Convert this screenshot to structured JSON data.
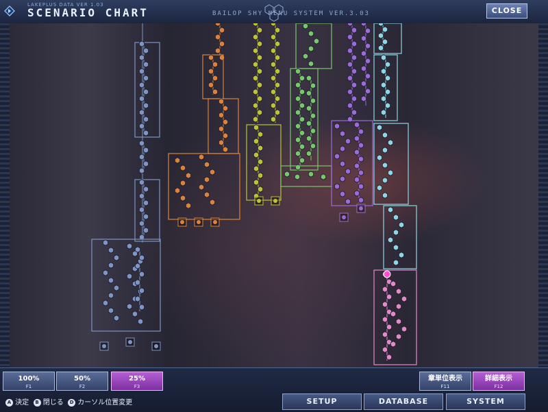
{
  "header": {
    "subtitle": "LAKEPLUS DATA VER 1.03",
    "title": "SCENARIO CHART",
    "version": "BAILOP SHY MENU SYSTEM VER.3.03",
    "close_label": "CLOSE"
  },
  "zoom_buttons": [
    {
      "label": "100%",
      "key": "F1",
      "active": false
    },
    {
      "label": "50%",
      "key": "F2",
      "active": false
    },
    {
      "label": "25%",
      "key": "F3",
      "active": true
    }
  ],
  "view_buttons": [
    {
      "label": "章単位表示",
      "key": "F11",
      "active": false
    },
    {
      "label": "詳細表示",
      "key": "F12",
      "active": true
    }
  ],
  "help": {
    "items": [
      {
        "key": "A",
        "text": "決定"
      },
      {
        "key": "B",
        "text": "閉じる"
      },
      {
        "key": "D",
        "text": "カーソル位置変更"
      }
    ]
  },
  "menu": {
    "setup": "SETUP",
    "database": "DATABASE",
    "system": "SYSTEM"
  },
  "routes": [
    {
      "color": "#7f95c4"
    },
    {
      "color": "#d9833e"
    },
    {
      "color": "#bcc23a"
    },
    {
      "color": "#77c86a"
    },
    {
      "color": "#9b6bd8"
    },
    {
      "color": "#8ed6e4"
    },
    {
      "color": "#e48ac8"
    }
  ]
}
